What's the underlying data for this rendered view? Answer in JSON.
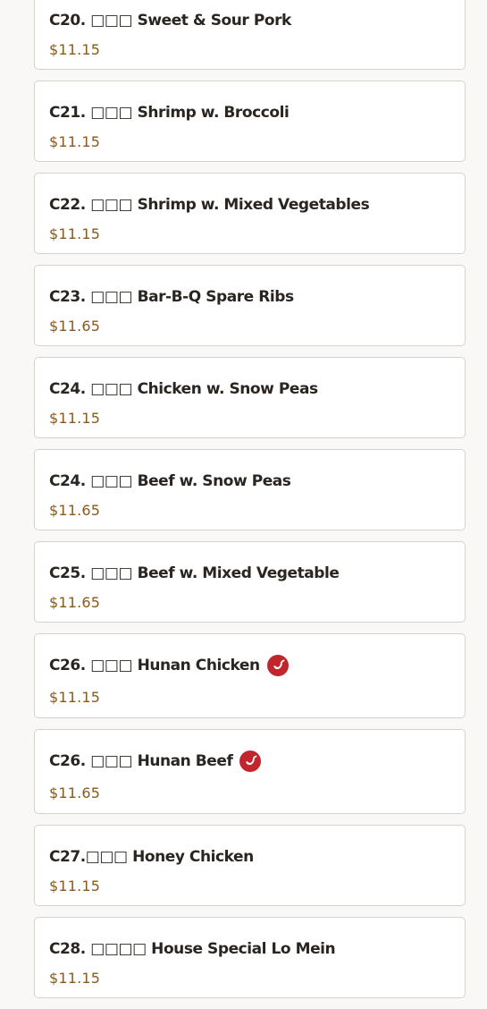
{
  "menu": {
    "items": [
      {
        "title": "C20. □□□ Sweet & Sour Pork",
        "price": "$11.15",
        "spicy": false
      },
      {
        "title": "C21. □□□ Shrimp w. Broccoli",
        "price": "$11.15",
        "spicy": false
      },
      {
        "title": "C22. □□□ Shrimp w. Mixed Vegetables",
        "price": "$11.15",
        "spicy": false
      },
      {
        "title": "C23. □□□ Bar-B-Q Spare Ribs",
        "price": "$11.65",
        "spicy": false
      },
      {
        "title": "C24. □□□ Chicken w. Snow Peas",
        "price": "$11.15",
        "spicy": false
      },
      {
        "title": "C24. □□□ Beef w. Snow Peas",
        "price": "$11.65",
        "spicy": false
      },
      {
        "title": "C25. □□□ Beef w. Mixed Vegetable",
        "price": "$11.65",
        "spicy": false
      },
      {
        "title": "C26. □□□ Hunan Chicken",
        "price": "$11.15",
        "spicy": true
      },
      {
        "title": "C26. □□□ Hunan Beef",
        "price": "$11.65",
        "spicy": true
      },
      {
        "title": "C27.□□□ Honey Chicken",
        "price": "$11.15",
        "spicy": false
      },
      {
        "title": "C28. □□□□ House Special Lo Mein",
        "price": "$11.15",
        "spicy": false
      }
    ]
  },
  "icons": {
    "spicy": "spicy-chili-icon"
  },
  "colors": {
    "background": "#f9f8f6",
    "card_border": "#d4d2cf",
    "title_text": "#2a2520",
    "price_text": "#8a5a1c",
    "spicy_badge": "#c0262c"
  }
}
